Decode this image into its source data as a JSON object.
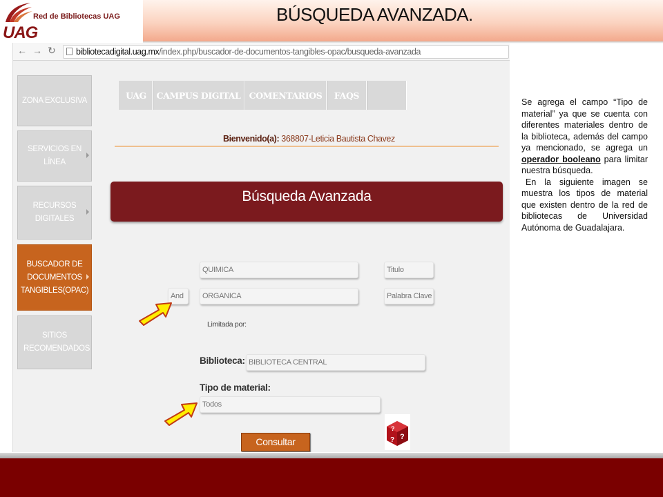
{
  "slide": {
    "logo_text": "Red de Bibliotecas UAG",
    "logo_mark": "UAG",
    "title": "BÚSQUEDA AVANZADA."
  },
  "browser": {
    "url_domain": "bibliotecadigital.uag.mx",
    "url_path": "/index.php/buscador-de-documentos-tangibles-opac/busqueda-avanzada"
  },
  "sidebar": {
    "items": [
      {
        "label": "ZONA EXCLUSIVA"
      },
      {
        "label": "SERVICIOS EN LÍNEA"
      },
      {
        "label": "RECURSOS DIGITALES"
      },
      {
        "label": "BUSCADOR DE DOCUMENTOS TANGIBLES(OPAC)"
      },
      {
        "label": "SITIOS RECOMENDADOS"
      }
    ]
  },
  "tabs": [
    {
      "label": "UAG"
    },
    {
      "label": "CAMPUS DIGITAL"
    },
    {
      "label": "COMENTARIOS"
    },
    {
      "label": "FAQS"
    },
    {
      "label": ""
    }
  ],
  "welcome": {
    "prefix": "Bienvenido(a):",
    "user": "368807-Leticia Bautista Chavez"
  },
  "search": {
    "banner": "Búsqueda Avanzada",
    "term1": "QUIMICA",
    "field1": "Titulo",
    "operator": "And",
    "term2": "ORGANICA",
    "field2": "Palabra Clave",
    "limit_label": "Limitada por:",
    "library_label": "Biblioteca:",
    "library_value": "BIBLIOTECA CENTRAL",
    "material_label": "Tipo de material:",
    "material_value": "Todos",
    "submit": "Consultar"
  },
  "description": {
    "p1_a": "Se agrega el campo “Tipo de material” ya que se cuenta con diferentes materiales dentro de la biblioteca, además del campo ya mencionado, se agrega un ",
    "p1_emph": "operador booleano",
    "p1_b": " para limitar nuestra búsqueda.",
    "p2": "En la siguiente imagen se muestra los tipos de material que existen dentro de la red de bibliotecas de Universidad Autónoma de Guadalajara."
  },
  "colors": {
    "brand_maroon": "#7b1a1e",
    "accent_orange": "#c7641e",
    "footer": "#7a0000",
    "arrow_fill": "#ffee00"
  }
}
